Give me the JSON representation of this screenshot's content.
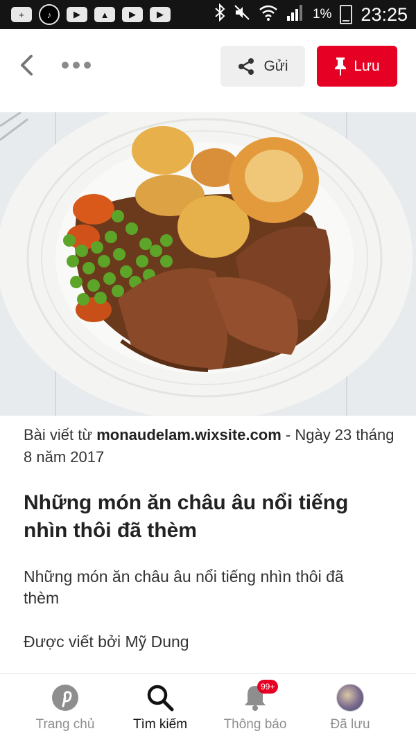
{
  "statusbar": {
    "battery_pct": "1%",
    "time": "23:25",
    "left_icons": [
      "add-icon",
      "tiktok-icon",
      "youtube-icon",
      "gallery-icon",
      "youtube-icon",
      "youtube-icon"
    ],
    "right_icons": [
      "bluetooth-icon",
      "mute-icon",
      "wifi-icon",
      "signal-icon",
      "battery-icon"
    ]
  },
  "topbar": {
    "send_label": "Gửi",
    "save_label": "Lưu",
    "accent_color": "#e60023"
  },
  "pin": {
    "source_prefix": "Bài viết từ",
    "source_site": "monaudelam.wixsite.com",
    "source_date": "- Ngày 23 tháng 8 năm 2017",
    "title": "Những món ăn châu âu nổi tiếng nhìn thôi đã thèm",
    "description": "Những món ăn châu âu nổi tiếng nhìn thôi đã thèm",
    "author": "Được viết bởi Mỹ Dung"
  },
  "bottom_nav": {
    "home": "Trang chủ",
    "search": "Tìm kiếm",
    "notifications": "Thông báo",
    "notifications_badge": "99+",
    "saved": "Đã lưu"
  }
}
